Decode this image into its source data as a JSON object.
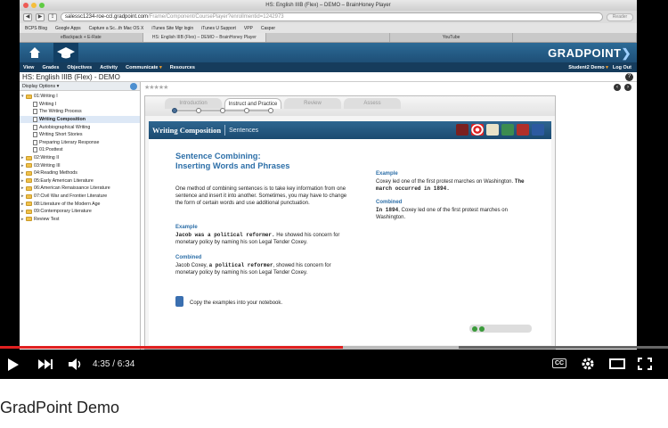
{
  "browser": {
    "window_title": "HS: English IIIB (Flex) – DEMO – BrainHoney Player",
    "url": "salessc1234-roe-ccl.gradpoint.com",
    "url_rest": "/Frame/Component/CoursePlayer?enrollmentid=1242973",
    "reader_label": "Reader",
    "bookmarks": [
      "BCPS Blog",
      "Google Apps",
      "Capture a Sc...th Mac OS X",
      "iTunes Site Mgr login",
      "iTunes U Support",
      "VPP",
      "Casper"
    ],
    "tabs": [
      {
        "label": "eBackpack + E-Rate"
      },
      {
        "label": "HS: English IIIB (Flex) – DEMO – BrainHoney Player"
      },
      {
        "label": ""
      },
      {
        "label": "YouTube"
      },
      {
        "label": ""
      }
    ]
  },
  "app": {
    "logo": "GRADPOINT",
    "menu": [
      "View",
      "Grades",
      "Objectives",
      "Activity",
      "Communicate",
      "Resources"
    ],
    "user": "Student2 Demo",
    "logout": "Log Out",
    "course_title": "HS: English IIIB (Flex) - DEMO",
    "help": "?"
  },
  "sidebar": {
    "header": "Display Options",
    "tree": [
      {
        "label": "01:Writing I",
        "type": "folder",
        "level": 0,
        "open": true
      },
      {
        "label": "Writing I",
        "type": "doc",
        "level": 1
      },
      {
        "label": "The Writing Process",
        "type": "doc",
        "level": 1
      },
      {
        "label": "Writing Composition",
        "type": "doc",
        "level": 1,
        "selected": true
      },
      {
        "label": "Autobiographical Writing",
        "type": "doc",
        "level": 1
      },
      {
        "label": "Writing Short Stories",
        "type": "doc",
        "level": 1
      },
      {
        "label": "Preparing Literary Response",
        "type": "doc",
        "level": 1
      },
      {
        "label": "01:Posttest",
        "type": "doc",
        "level": 1
      },
      {
        "label": "02:Writing II",
        "type": "folder",
        "level": 0
      },
      {
        "label": "03:Writing III",
        "type": "folder",
        "level": 0
      },
      {
        "label": "04:Reading Methods",
        "type": "folder",
        "level": 0
      },
      {
        "label": "05:Early American Literature",
        "type": "folder",
        "level": 0
      },
      {
        "label": "06:American Renaissance Literature",
        "type": "folder",
        "level": 0
      },
      {
        "label": "07:Civil War and Frontier Literature",
        "type": "folder",
        "level": 0
      },
      {
        "label": "08:Literature of the Modern Age",
        "type": "folder",
        "level": 0
      },
      {
        "label": "09:Contemporary Literature",
        "type": "folder",
        "level": 0
      },
      {
        "label": "Review Test",
        "type": "folder",
        "level": 0
      }
    ]
  },
  "lesson": {
    "steps": [
      "Introduction",
      "Instruct and Practice",
      "Review",
      "Assess"
    ],
    "active_step": 1,
    "bar_title": "Writing Composition",
    "bar_subtitle": "Sentences",
    "title_line1": "Sentence Combining:",
    "title_line2": "Inserting Words and Phrases",
    "intro": "One method of combining sentences is to take key information from one sentence and insert it into another. Sometimes, you may have to change the form of certain words and use additional punctuation.",
    "ex1_label": "Example",
    "ex1_plain": "Jacob was a political reformer.",
    "ex1_rest": " He showed his concern for monetary policy by naming his son Legal Tender Coxey.",
    "comb1_label": "Combined",
    "comb1_start": "Jacob Coxey, ",
    "comb1_bold": "a political reformer",
    "comb1_end": ", showed his concern for monetary policy by naming his son Legal Tender Coxey.",
    "ex2_label": "Example",
    "ex2_plain": "Coxey led one of the first protest marches on Washington. ",
    "ex2_bold": "The march occurred in 1894.",
    "comb2_label": "Combined",
    "comb2_bold": "In 1894",
    "comb2_rest": ", Coxey led one of the first protest marches on Washington.",
    "notebook_text": "Copy the examples into your notebook."
  },
  "video": {
    "time": "4:35 / 6:34",
    "progress_fraction": 0.698,
    "cc": "CC",
    "title": "GradPoint Demo"
  },
  "colors": {
    "header_blue": "#2c6a96",
    "lesson_blue": "#2d6fa8",
    "progress_red": "#e02020"
  }
}
